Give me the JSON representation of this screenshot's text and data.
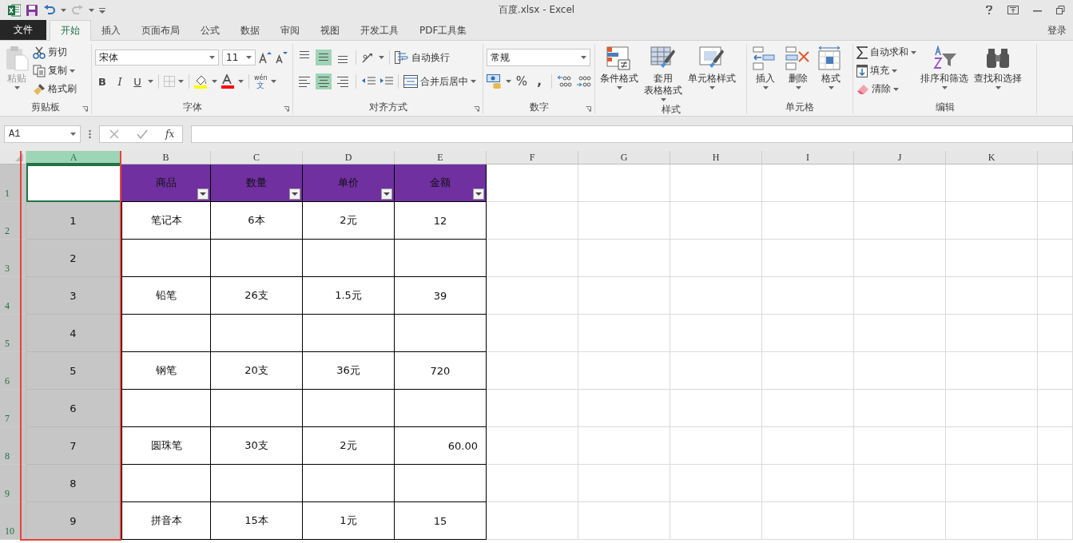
{
  "title_bar": {
    "title": "百度.xlsx - Excel"
  },
  "tabs": [
    {
      "label": "文件",
      "kind": "file",
      "selected": false
    },
    {
      "label": "开始",
      "kind": "tab",
      "selected": true
    },
    {
      "label": "插入",
      "kind": "tab",
      "selected": false
    },
    {
      "label": "页面布局",
      "kind": "tab",
      "selected": false
    },
    {
      "label": "公式",
      "kind": "tab",
      "selected": false
    },
    {
      "label": "数据",
      "kind": "tab",
      "selected": false
    },
    {
      "label": "审阅",
      "kind": "tab",
      "selected": false
    },
    {
      "label": "视图",
      "kind": "tab",
      "selected": false
    },
    {
      "label": "开发工具",
      "kind": "tab",
      "selected": false
    },
    {
      "label": "PDF工具集",
      "kind": "tab",
      "selected": false
    }
  ],
  "account": {
    "label": "登录"
  },
  "ribbon": {
    "clipboard": {
      "title": "剪贴板",
      "paste": {
        "label": "粘贴",
        "disabled": true
      },
      "cut": "剪切",
      "copy": "复制",
      "format_painter": "格式刷"
    },
    "font": {
      "title": "字体",
      "font_name": "宋体",
      "font_size": "11",
      "bold": "B",
      "italic": "I",
      "underline": "U",
      "phonetic": "wén",
      "phonetic_char": "文"
    },
    "alignment": {
      "title": "对齐方式",
      "vertical": [
        {
          "selected": false
        },
        {
          "selected": true
        },
        {
          "selected": false
        }
      ],
      "horizontal": [
        {
          "selected": false
        },
        {
          "selected": true
        },
        {
          "selected": false
        }
      ],
      "wrap_text": "自动换行",
      "merge_center": "合并后居中"
    },
    "number": {
      "title": "数字",
      "format": "常规",
      "percent": "%",
      "comma": ","
    },
    "styles": {
      "title": "样式",
      "buttons": [
        {
          "label": "条件格式",
          "kind": "conditional"
        },
        {
          "label_lines": [
            "套用",
            "表格格式"
          ],
          "kind": "table"
        },
        {
          "label": "单元格样式",
          "kind": "cellstyle"
        }
      ]
    },
    "cells": {
      "title": "单元格",
      "buttons": [
        {
          "label": "插入",
          "kind": "insert"
        },
        {
          "label": "删除",
          "kind": "delete"
        },
        {
          "label": "格式",
          "kind": "format"
        }
      ]
    },
    "editing": {
      "title": "编辑",
      "autosum": "自动求和",
      "fill": "填充",
      "clear": "清除",
      "sort_filter": "排序和筛选",
      "find_select": "查找和选择"
    }
  },
  "formula_bar": {
    "name_box": "A1",
    "function_label": "fx"
  },
  "sheet": {
    "columns": [
      {
        "label": "A",
        "selected": true,
        "highlighted": true
      },
      {
        "label": "B",
        "selected": false,
        "highlighted": false
      },
      {
        "label": "C",
        "selected": false,
        "highlighted": false
      },
      {
        "label": "D",
        "selected": false,
        "highlighted": false
      },
      {
        "label": "E",
        "selected": false,
        "highlighted": false
      },
      {
        "label": "F",
        "selected": false,
        "highlighted": false
      },
      {
        "label": "G",
        "selected": false,
        "highlighted": false
      },
      {
        "label": "H",
        "selected": false,
        "highlighted": false
      },
      {
        "label": "I",
        "selected": false,
        "highlighted": false
      },
      {
        "label": "J",
        "selected": false,
        "highlighted": false
      },
      {
        "label": "K",
        "selected": false,
        "highlighted": false
      }
    ],
    "rows": [
      {
        "header": "1",
        "selected": true,
        "kind": "table_header",
        "cells": [
          null,
          "商品",
          "数量",
          "单价",
          "金额"
        ]
      },
      {
        "header": "2",
        "selected": true,
        "kind": "data",
        "cells": [
          "1",
          "笔记本",
          "6本",
          "2元",
          "12"
        ]
      },
      {
        "header": "3",
        "selected": true,
        "kind": "data",
        "cells": [
          "2",
          null,
          null,
          null,
          null
        ]
      },
      {
        "header": "4",
        "selected": true,
        "kind": "data",
        "cells": [
          "3",
          "铅笔",
          "26支",
          "1.5元",
          "39"
        ]
      },
      {
        "header": "5",
        "selected": true,
        "kind": "data",
        "cells": [
          "4",
          null,
          null,
          null,
          null
        ]
      },
      {
        "header": "6",
        "selected": true,
        "kind": "data",
        "cells": [
          "5",
          "钢笔",
          "20支",
          "36元",
          "720"
        ]
      },
      {
        "header": "7",
        "selected": true,
        "kind": "data",
        "cells": [
          "6",
          null,
          null,
          null,
          null
        ]
      },
      {
        "header": "8",
        "selected": true,
        "kind": "data",
        "cells": [
          "7",
          "圆珠笔",
          "30支",
          "2元",
          {
            "text": "60.00",
            "right_aligned": true
          }
        ]
      },
      {
        "header": "9",
        "selected": true,
        "kind": "data",
        "cells": [
          "8",
          null,
          null,
          null,
          null
        ]
      },
      {
        "header": "10",
        "selected": true,
        "kind": "data",
        "cells": [
          "9",
          "拼音本",
          "15本",
          "1元",
          "15"
        ]
      }
    ]
  }
}
